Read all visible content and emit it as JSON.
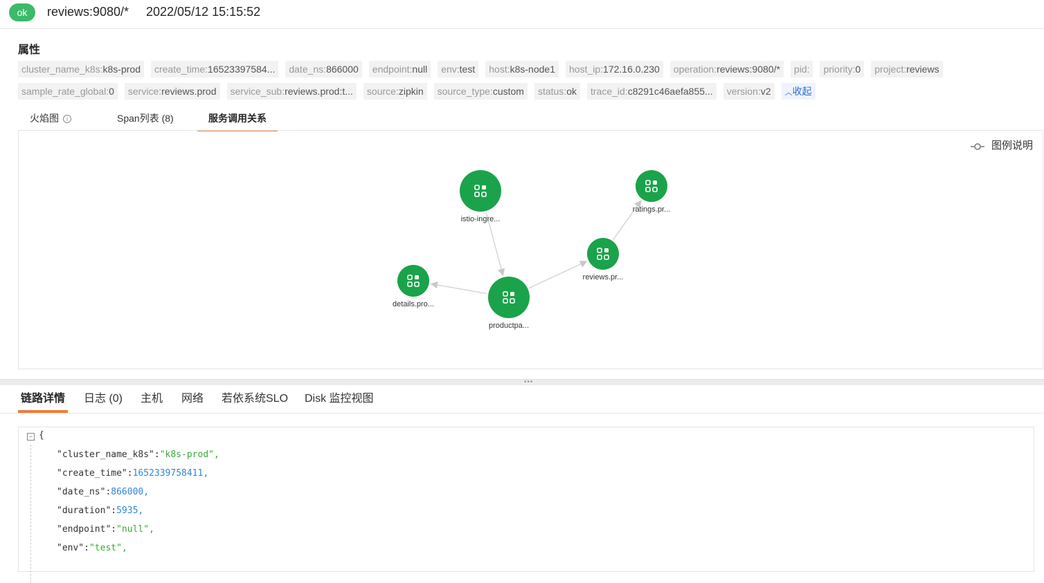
{
  "header": {
    "status": "ok",
    "resource": "reviews:9080/*",
    "timestamp": "2022/05/12 15:15:52",
    "status_color": "#3cba6b"
  },
  "attributes": {
    "title": "属性",
    "rows": [
      [
        {
          "key": "cluster_name_k8s:",
          "value": "k8s-prod"
        },
        {
          "key": "create_time:",
          "value": "16523397584..."
        },
        {
          "key": "date_ns:",
          "value": "866000"
        },
        {
          "key": "endpoint:",
          "value": "null"
        },
        {
          "key": "env:",
          "value": "test"
        },
        {
          "key": "host:",
          "value": "k8s-node1"
        },
        {
          "key": "host_ip:",
          "value": "172.16.0.230"
        },
        {
          "key": "operation:",
          "value": "reviews:9080/*"
        },
        {
          "key": "pid:",
          "value": ""
        },
        {
          "key": "priority:",
          "value": "0"
        },
        {
          "key": "project:",
          "value": "reviews"
        }
      ],
      [
        {
          "key": "sample_rate_global:",
          "value": "0"
        },
        {
          "key": "service:",
          "value": "reviews.prod"
        },
        {
          "key": "service_sub:",
          "value": "reviews.prod:t..."
        },
        {
          "key": "source:",
          "value": "zipkin"
        },
        {
          "key": "source_type:",
          "value": "custom"
        },
        {
          "key": "status:",
          "value": "ok"
        },
        {
          "key": "trace_id:",
          "value": "c8291c46aefa855..."
        },
        {
          "key": "version:",
          "value": "v2"
        }
      ]
    ],
    "collapse_label": "收起"
  },
  "top_tabs": {
    "flame": "火焰图",
    "span_list": "Span列表 (8)",
    "service_map": "服务调用关系",
    "active": "service_map"
  },
  "graph": {
    "legend_label": "图例说明",
    "node_color": "#1aa34a",
    "nodes": [
      {
        "id": "istio",
        "label": "istio-ingre..."
      },
      {
        "id": "ratings",
        "label": "ratings.pr..."
      },
      {
        "id": "reviews",
        "label": "reviews.pr..."
      },
      {
        "id": "details",
        "label": "details.pro..."
      },
      {
        "id": "productpage",
        "label": "productpa..."
      }
    ],
    "edges": [
      {
        "from": "istio",
        "to": "productpage"
      },
      {
        "from": "productpage",
        "to": "details"
      },
      {
        "from": "productpage",
        "to": "reviews"
      },
      {
        "from": "reviews",
        "to": "ratings"
      }
    ]
  },
  "bottom_tabs": {
    "items": [
      "链路详情",
      "日志 (0)",
      "主机",
      "网络",
      "若依系统SLO",
      "Disk 监控视图"
    ],
    "active": 0
  },
  "json_view": {
    "open_brace": "{",
    "lines": [
      {
        "key": "\"cluster_name_k8s\"",
        "value": "\"k8s-prod\"",
        "type": "string"
      },
      {
        "key": "\"create_time\"",
        "value": "1652339758411",
        "type": "number"
      },
      {
        "key": "\"date_ns\"",
        "value": "866000",
        "type": "number"
      },
      {
        "key": "\"duration\"",
        "value": "5935",
        "type": "number"
      },
      {
        "key": "\"endpoint\"",
        "value": "\"null\"",
        "type": "string"
      },
      {
        "key": "\"env\"",
        "value": "\"test\"",
        "type": "string"
      }
    ]
  }
}
